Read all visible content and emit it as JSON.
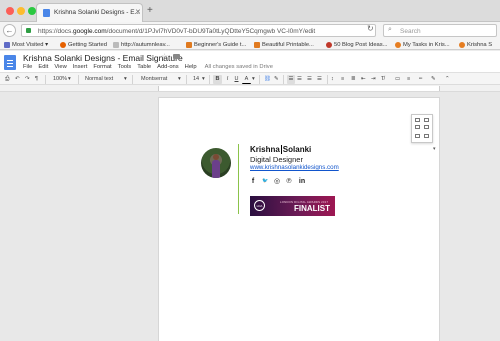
{
  "window": {
    "tab_title": "Krishna Solanki Designs - E...",
    "new_tab_symbol": "+"
  },
  "navbar": {
    "url_prefix": "https://docs.",
    "url_domain": "google.com",
    "url_path": "/document/d/1PJvl7hVD0vT-bDU9Ta0tLyQDtteY5Cqmgwb VC-l0mY/edit",
    "search_placeholder": "Search"
  },
  "bookmarks": [
    {
      "label": "Most Visited ▾",
      "color": "#5f6bc6"
    },
    {
      "label": "Getting Started",
      "color": "#e66000"
    },
    {
      "label": "http://autumnleav...",
      "color": "#888888"
    },
    {
      "label": "Beginner's Guide t...",
      "color": "#e07a1f"
    },
    {
      "label": "Beautiful Printable...",
      "color": "#e07a1f"
    },
    {
      "label": "50 Blog Post Ideas...",
      "color": "#c0392b"
    },
    {
      "label": "My Tasks in Kris...",
      "color": "#e67e22"
    },
    {
      "label": "Krishna S",
      "color": "#e67e22"
    }
  ],
  "docs": {
    "title": "Krishna Solanki Designs - Email Signature",
    "menu": [
      "File",
      "Edit",
      "View",
      "Insert",
      "Format",
      "Tools",
      "Table",
      "Add-ons",
      "Help"
    ],
    "saved_status": "All changes saved in Drive"
  },
  "toolbar": {
    "zoom": "100%",
    "style": "Normal text",
    "font": "Montserrat",
    "size": "14",
    "bold": "B",
    "italic": "I",
    "underline": "U",
    "text_color": "A"
  },
  "signature": {
    "name_first": "Krishna",
    "name_last": "Solanki",
    "role": "Digital Designer",
    "website": "www.krishnasolankidesigns.com",
    "social": [
      "f",
      "🐦",
      "◎",
      "℗",
      "in"
    ],
    "badge_circle": "LDA",
    "badge_small": "LONDON DIGITAL AWARDS 2017",
    "badge_big": "FINALIST"
  },
  "colors": {
    "accent_line": "#8bc34a",
    "link": "#1155cc",
    "docs_blue": "#4a86e8"
  }
}
